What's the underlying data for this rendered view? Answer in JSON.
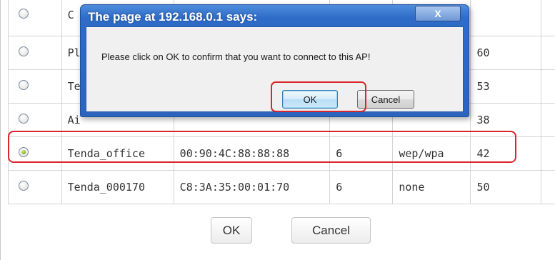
{
  "dialog": {
    "title": "The page at 192.168.0.1 says:",
    "close_glyph": "X",
    "message": "Please click on OK to confirm that you want to connect to this AP!",
    "ok_label": "OK",
    "cancel_label": "Cancel"
  },
  "table": {
    "rows": [
      {
        "ssid": "C",
        "mac": "",
        "channel": "",
        "security": "",
        "signal": "",
        "selected": false
      },
      {
        "ssid": "Pl",
        "mac": "",
        "channel": "",
        "security": "",
        "signal": "60",
        "selected": false
      },
      {
        "ssid": "Te",
        "mac": "",
        "channel": "",
        "security": "",
        "signal": "53",
        "selected": false
      },
      {
        "ssid": "Ai",
        "mac": "",
        "channel": "",
        "security": "",
        "signal": "38",
        "selected": false
      },
      {
        "ssid": "Tenda_office",
        "mac": "00:90:4C:88:88:88",
        "channel": "6",
        "security": "wep/wpa",
        "signal": "42",
        "selected": true
      },
      {
        "ssid": "Tenda_000170",
        "mac": "C8:3A:35:00:01:70",
        "channel": "6",
        "security": "none",
        "signal": "50",
        "selected": false
      }
    ]
  },
  "footer": {
    "ok_label": "OK",
    "cancel_label": "Cancel"
  },
  "colors": {
    "highlight": "#d9262c",
    "dialog_title_bar": "#2e6cc8",
    "selected_radio": "#8bb21c"
  }
}
